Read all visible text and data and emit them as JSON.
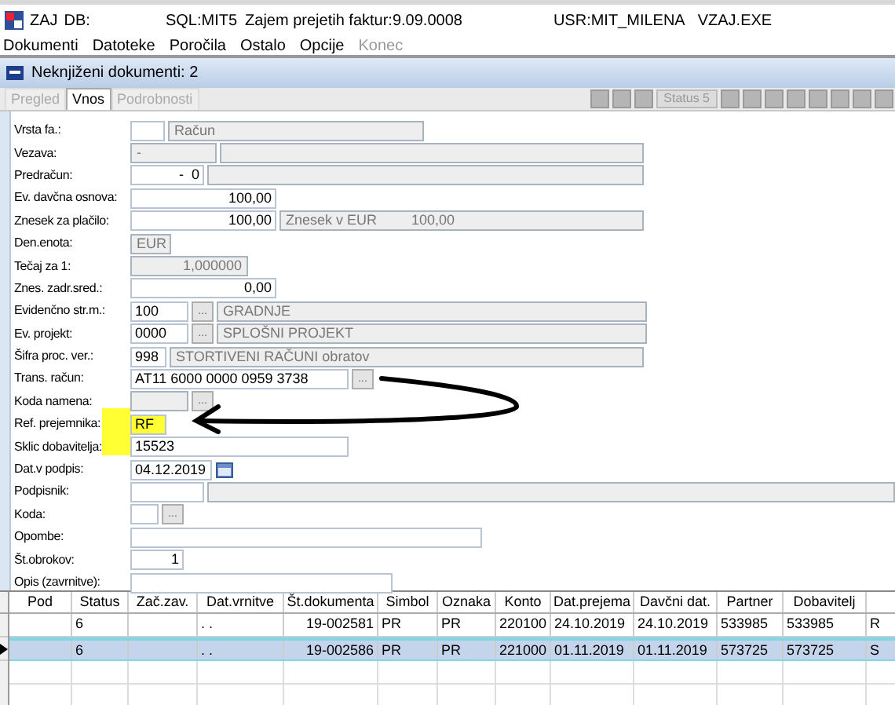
{
  "window": {
    "app": "ZAJ",
    "db": "DB:",
    "sql": "SQL:MIT5",
    "title": "Zajem prejetih faktur:9.09.0008",
    "user": "USR:MIT_MILENA",
    "exe": "VZAJ.EXE"
  },
  "menu": [
    {
      "label": "Dokumenti",
      "disabled": false
    },
    {
      "label": "Datoteke",
      "disabled": false
    },
    {
      "label": "Poročila",
      "disabled": false
    },
    {
      "label": "Ostalo",
      "disabled": false
    },
    {
      "label": "Opcije",
      "disabled": false
    },
    {
      "label": "Konec",
      "disabled": true
    }
  ],
  "document_window": {
    "title": "Neknjiženi dokumenti: 2"
  },
  "tabs": [
    {
      "label": "Pregled",
      "selected": false,
      "disabled": true
    },
    {
      "label": "Vnos",
      "selected": true,
      "disabled": false
    },
    {
      "label": "Podrobnosti",
      "selected": false,
      "disabled": true
    }
  ],
  "toolbar": {
    "status_button": "Status 5"
  },
  "annotation_arrow": true,
  "form": [
    {
      "label": "Vrsta fa.:",
      "highlighted": false,
      "parts": [
        {
          "kind": "input"
        },
        {
          "kind": "readonly",
          "value": "Račun"
        }
      ]
    },
    {
      "label": "Vezava:",
      "highlighted": false,
      "parts": [
        {
          "kind": "readonly",
          "value": "-"
        },
        {
          "kind": "readonly"
        }
      ]
    },
    {
      "label": "Predračun:",
      "highlighted": false,
      "parts": [
        {
          "kind": "number",
          "value": "-  0"
        },
        {
          "kind": "readonly"
        }
      ]
    },
    {
      "label": "Ev. davčna osnova:",
      "highlighted": false,
      "parts": [
        {
          "kind": "number",
          "value": "100,00"
        }
      ]
    },
    {
      "label": "Znesek za plačilo:",
      "highlighted": false,
      "parts": [
        {
          "kind": "number",
          "value": "100,00"
        },
        {
          "kind": "readonly_pair",
          "label": "Znesek v EUR",
          "value": "100,00"
        }
      ]
    },
    {
      "label": "Den.enota:",
      "highlighted": false,
      "parts": [
        {
          "kind": "readonly",
          "value": "EUR"
        }
      ]
    },
    {
      "label": "Tečaj za 1:",
      "highlighted": false,
      "parts": [
        {
          "kind": "readonly_number",
          "value": "1,000000"
        }
      ]
    },
    {
      "label": "Znes. zadr.sred.:",
      "highlighted": false,
      "parts": [
        {
          "kind": "number",
          "value": "0,00"
        }
      ]
    },
    {
      "label": "Evidenčno str.m.:",
      "highlighted": false,
      "parts": [
        {
          "kind": "input",
          "value": "100"
        },
        {
          "kind": "button",
          "value": "..."
        },
        {
          "kind": "readonly",
          "value": "GRADNJE"
        }
      ]
    },
    {
      "label": "Ev. projekt:",
      "highlighted": false,
      "parts": [
        {
          "kind": "input",
          "value": "0000"
        },
        {
          "kind": "button",
          "value": "..."
        },
        {
          "kind": "readonly",
          "value": "SPLOŠNI PROJEKT"
        }
      ]
    },
    {
      "label": "Šifra proc. ver.:",
      "highlighted": false,
      "parts": [
        {
          "kind": "input",
          "value": "998"
        },
        {
          "kind": "readonly",
          "value": "STORTIVENI RAČUNI obratov"
        }
      ]
    },
    {
      "label": "Trans. račun:",
      "highlighted": false,
      "parts": [
        {
          "kind": "input",
          "value": "AT11 6000 0000 0959 3738"
        },
        {
          "kind": "button",
          "value": "..."
        }
      ]
    },
    {
      "label": "Koda namena:",
      "highlighted": false,
      "parts": [
        {
          "kind": "readonly"
        },
        {
          "kind": "button",
          "value": "..."
        }
      ]
    },
    {
      "label": "Ref. prejemnika:",
      "highlighted": true,
      "parts": [
        {
          "kind": "input",
          "value": "RF"
        }
      ]
    },
    {
      "label": "Sklic dobavitelja:",
      "highlighted": false,
      "parts": [
        {
          "kind": "input",
          "value": "15523"
        }
      ]
    },
    {
      "label": "Dat.v podpis:",
      "highlighted": false,
      "parts": [
        {
          "kind": "input",
          "value": "04.12.2019"
        },
        {
          "kind": "calendar"
        }
      ]
    },
    {
      "label": "Podpisnik:",
      "highlighted": false,
      "parts": [
        {
          "kind": "input"
        },
        {
          "kind": "readonly"
        }
      ]
    },
    {
      "label": "Koda:",
      "highlighted": false,
      "parts": [
        {
          "kind": "input"
        },
        {
          "kind": "button",
          "value": "..."
        }
      ]
    },
    {
      "label": "Opombe:",
      "highlighted": false,
      "parts": [
        {
          "kind": "input"
        }
      ]
    },
    {
      "label": "Št.obrokov:",
      "highlighted": false,
      "parts": [
        {
          "kind": "number",
          "value": "1"
        }
      ]
    },
    {
      "label": "Opis (zavrnitve):",
      "highlighted": false,
      "parts": [
        {
          "kind": "input"
        }
      ]
    }
  ],
  "table": {
    "columns": [
      "Pod",
      "Status",
      "Zač.zav.",
      "Dat.vrnitve",
      "Št.dokumenta",
      "Simbol",
      "Oznaka",
      "Konto",
      "Dat.prejema",
      "Davčni dat.",
      "Partner",
      "Dobavitelj"
    ],
    "rows": [
      {
        "selected": false,
        "cells": [
          "",
          "6",
          "",
          ". .",
          "19-002581",
          "PR",
          "PR",
          "220100",
          "24.10.2019",
          "24.10.2019",
          "533985",
          "533985",
          "R"
        ]
      },
      {
        "selected": true,
        "cells": [
          "",
          "6",
          "",
          ". .",
          "19-002586",
          "PR",
          "PR",
          "221000",
          "01.11.2019",
          "01.11.2019",
          "573725",
          "573725",
          "S"
        ]
      }
    ]
  }
}
